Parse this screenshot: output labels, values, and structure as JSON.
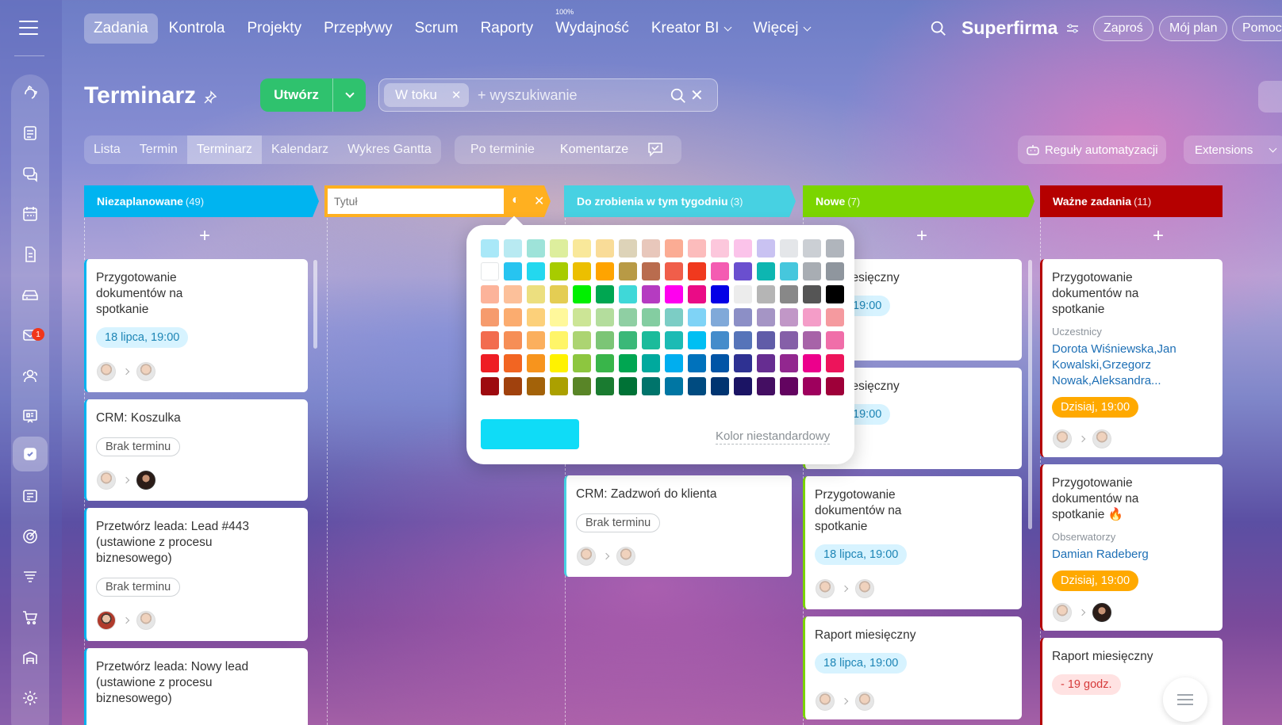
{
  "topnav": {
    "items": [
      "Zadania",
      "Kontrola",
      "Projekty",
      "Przepływy",
      "Scrum",
      "Raporty",
      "Wydajność",
      "Kreator BI",
      "Więcej"
    ],
    "wydajnosc_badge": "100%",
    "brand": "Superfirma",
    "buttons": [
      "Zaproś",
      "Mój plan",
      "Pomoc"
    ]
  },
  "header": {
    "title": "Terminarz",
    "create_label": "Utwórz",
    "filter_chip": "W toku",
    "search_placeholder": "+ wyszukiwanie"
  },
  "view_tabs": [
    "Lista",
    "Termin",
    "Terminarz",
    "Kalendarz",
    "Wykres Gantta"
  ],
  "sort_tabs": [
    "Po terminie",
    "Komentarze"
  ],
  "automation_label": "Reguły automatyzacji",
  "extensions_label": "Extensions",
  "rail": {
    "mail_badge": "1"
  },
  "columns": [
    {
      "title": "Niezaplanowane",
      "count": "(49)",
      "color": "#00b4f0"
    },
    {
      "title": "",
      "count": "",
      "color": "#ffb020"
    },
    {
      "title": "Do zrobienia w tym tygodniu",
      "count": "(3)",
      "color": "#47d1e2"
    },
    {
      "title": "Nowe",
      "count": "(7)",
      "color": "#7bd500"
    },
    {
      "title": "Ważne zadania",
      "count": "(11)",
      "color": "#b50000"
    }
  ],
  "title_input_placeholder": "Tytuł",
  "cards": {
    "c1": {
      "title": "Przygotowanie dokumentów na spotkanie",
      "date": "18 lipca, 19:00"
    },
    "c2": {
      "title": "CRM: Koszulka",
      "date": "Brak terminu"
    },
    "c3": {
      "title": "Przetwórz leada: Lead #443 (ustawione z procesu biznesowego)",
      "date": "Brak terminu"
    },
    "c4": {
      "title": "Przetwórz leada: Nowy lead (ustawione z procesu biznesowego)"
    },
    "c5": {
      "title": "CRM: Zadzwoń do klienta",
      "date": "Brak terminu"
    },
    "c6": {
      "title": "iesięczny",
      "date": ", 19:00"
    },
    "c7": {
      "title": "iesięczny",
      "date": ", 19:00"
    },
    "c8": {
      "title": "Przygotowanie dokumentów na spotkanie",
      "date": "18 lipca, 19:00"
    },
    "c9": {
      "title": "Raport miesięczny",
      "date": "18 lipca, 19:00"
    },
    "c10": {
      "title": "Przygotowanie dokumentów na spotkanie",
      "label": "Uczestnicy",
      "people": "Dorota Wiśniewska,Jan Kowalski,Grzegorz Nowak,Aleksandra...",
      "date": "Dzisiaj, 19:00"
    },
    "c11": {
      "title": "Przygotowanie dokumentów na spotkanie",
      "label": "Obserwatorzy",
      "people": "Damian Radeberg",
      "date": "Dzisiaj, 19:00"
    },
    "c12": {
      "title": "Raport miesięczny",
      "date": "- 19 godz."
    }
  },
  "palette": {
    "rows": [
      [
        "#a9e8f8",
        "#b8eaf2",
        "#9ee3d9",
        "#ddee9d",
        "#f9e89a",
        "#f9dc98",
        "#ddd3b8",
        "#e8c7bb",
        "#fbac94",
        "#fcbcbc",
        "#fcc7dc",
        "#fbc3ea",
        "#c9c2f2",
        "#e4e6e9",
        "#cbcfd4",
        "#b0b5bc"
      ],
      [
        "#ffffff",
        "#27c4f0",
        "#23d8ef",
        "#a7cc00",
        "#ecbf00",
        "#ffa400",
        "#b89a45",
        "#b96c4e",
        "#f05e4a",
        "#f0391e",
        "#f45cb2",
        "#6a4fcf",
        "#0db6b1",
        "#46c7dd",
        "#a8adb3",
        "#8f969e"
      ],
      [
        "#fcb39a",
        "#fcc09a",
        "#ecdf7f",
        "#e4cd53",
        "#00f000",
        "#00a651",
        "#3fd8d8",
        "#b53bc1",
        "#ff00ef",
        "#ea0b86",
        "#0400e6",
        "#ececec",
        "#b5b5b5",
        "#888888",
        "#555555",
        "#000000"
      ],
      [
        "#f69b6d",
        "#fbac6f",
        "#fcd07a",
        "#fff89b",
        "#cce596",
        "#b4dd9d",
        "#8fcfa3",
        "#84cda1",
        "#7ccdc5",
        "#7fd3f6",
        "#80a9d9",
        "#8c8fc6",
        "#a595c5",
        "#c197c7",
        "#f49dc8",
        "#f59a9f"
      ],
      [
        "#f26c4f",
        "#f68e56",
        "#fbaf5d",
        "#fff568",
        "#acd472",
        "#7cc576",
        "#3bb878",
        "#1bbb9b",
        "#1cbbb4",
        "#00bff3",
        "#448ccb",
        "#5674b9",
        "#605ca8",
        "#855fa8",
        "#a763a8",
        "#f06ea9"
      ],
      [
        "#ee1d24",
        "#f26522",
        "#f7941d",
        "#fff200",
        "#8dc63f",
        "#39b54a",
        "#00a651",
        "#00a99d",
        "#00aeef",
        "#0072bc",
        "#0054a6",
        "#2e3192",
        "#662d91",
        "#92278f",
        "#ec008c",
        "#ed145b"
      ],
      [
        "#9d0a0f",
        "#a0410d",
        "#a36209",
        "#aba000",
        "#598527",
        "#1a7b30",
        "#007236",
        "#00746b",
        "#0076a3",
        "#004b80",
        "#003471",
        "#1b1464",
        "#440e62",
        "#630460",
        "#9e005d",
        "#9e0039"
      ]
    ],
    "selected": "#0fdcf7",
    "custom_label": "Kolor niestandardowy"
  }
}
